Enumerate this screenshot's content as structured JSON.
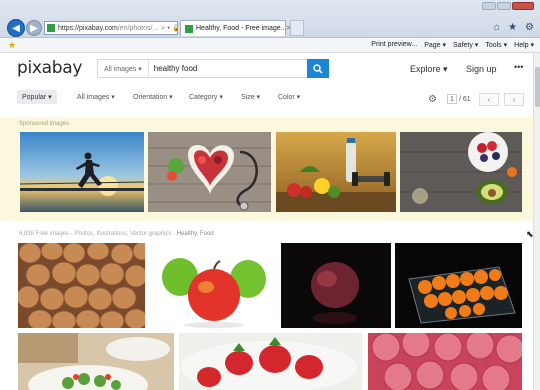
{
  "browser": {
    "address": {
      "scheme": "https://",
      "host": "pixabay.com",
      "path": "/en/photos/...",
      "icons": "⌕ ▾ 🔒 ↻"
    },
    "active_tab": {
      "label": "Healthy, Food - Free image...",
      "close": "×"
    },
    "command_bar": [
      "Print preview...",
      "Page ▾",
      "Safety ▾",
      "Tools ▾",
      "Help ▾"
    ]
  },
  "header": {
    "logo": "pixabay",
    "search_category": "All images ▾",
    "search_value": "healthy food",
    "explore": "Explore ▾",
    "signup": "Sign up",
    "more": "•••"
  },
  "filters": {
    "items": [
      "Popular ▾",
      "All images ▾",
      "Orientation ▾",
      "Category ▾",
      "Size ▾",
      "Color ▾"
    ],
    "page_current": "1",
    "page_total": "/ 61",
    "prev": "‹",
    "next": "›"
  },
  "sponsored": {
    "label": "Sponsored images"
  },
  "results": {
    "label": "6,838 Free images · Photos, Illustrations, Vector graphics · ",
    "query": "Healthy, Food"
  },
  "icons": {
    "back": "back-arrow-icon",
    "forward": "forward-arrow-icon",
    "search": "magnifier-icon",
    "settings": "gear-icon",
    "home": "home-icon",
    "favorites": "star-icon",
    "tools": "gear-icon"
  },
  "colors": {
    "brand_blue": "#1a87d6",
    "sponsored_bg": "#fbf8dd",
    "ie_chrome": "#dfe7f1"
  }
}
